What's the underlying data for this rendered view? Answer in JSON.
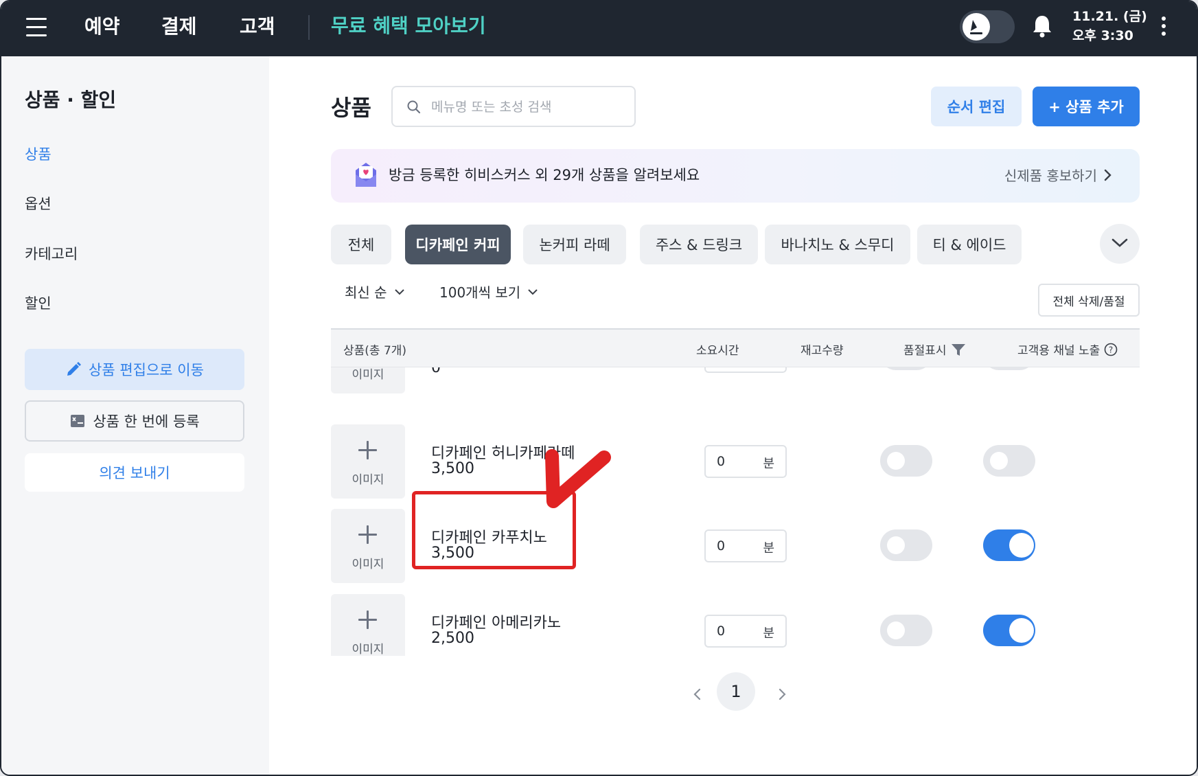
{
  "header": {
    "nav": [
      "예약",
      "결제",
      "고객"
    ],
    "promo": "무료 혜택 모아보기",
    "date": "11.21. (금)",
    "time": "오후 3:30"
  },
  "sidebar": {
    "title": "상품 · 할인",
    "items": [
      {
        "label": "상품",
        "active": true
      },
      {
        "label": "옵션"
      },
      {
        "label": "카테고리"
      },
      {
        "label": "할인"
      }
    ],
    "btn_edit": "상품 편집으로 이동",
    "btn_bulk": "상품 한 번에 등록",
    "btn_feedback": "의견 보내기"
  },
  "main": {
    "title": "상품",
    "search_placeholder": "메뉴명 또는 초성 검색",
    "btn_order": "순서 편집",
    "btn_add": "+ 상품 추가",
    "banner_text": "방금 등록한 히비스커스 외 29개  상품을 알려보세요",
    "banner_link": "신제품 홍보하기",
    "tabs": [
      "전체",
      "디카페인 커피",
      "논커피 라떼",
      "주스 & 드링크",
      "바나치노 & 스무디",
      "티 & 에이드"
    ],
    "active_tab": 1,
    "sort": "최신 순",
    "page_size": "100개씩 보기",
    "btn_delete_all": "전체 삭제/품절",
    "table_headers": {
      "product": "상품(총 7개)",
      "time": "소요시간",
      "stock": "재고수량",
      "soldout": "품절표시",
      "channel": "고객용 채널 노출"
    },
    "image_label": "이미지",
    "time_unit": "분",
    "partial_row": {
      "image_label": "이미지",
      "price": "0"
    },
    "rows": [
      {
        "name": "디카페인 허니카페라떼",
        "price": "3,500",
        "time": "0",
        "soldout": false,
        "channel": false
      },
      {
        "name": "디카페인 카푸치노",
        "price": "3,500",
        "time": "0",
        "soldout": false,
        "channel": true
      },
      {
        "name": "디카페인 아메리카노",
        "price": "2,500",
        "time": "0",
        "soldout": false,
        "channel": true
      }
    ],
    "page": "1"
  },
  "colors": {
    "accent": "#2f7fe8",
    "header_bg": "#1f2630",
    "promo": "#4fd1c5",
    "annotation_red": "#e02323"
  }
}
